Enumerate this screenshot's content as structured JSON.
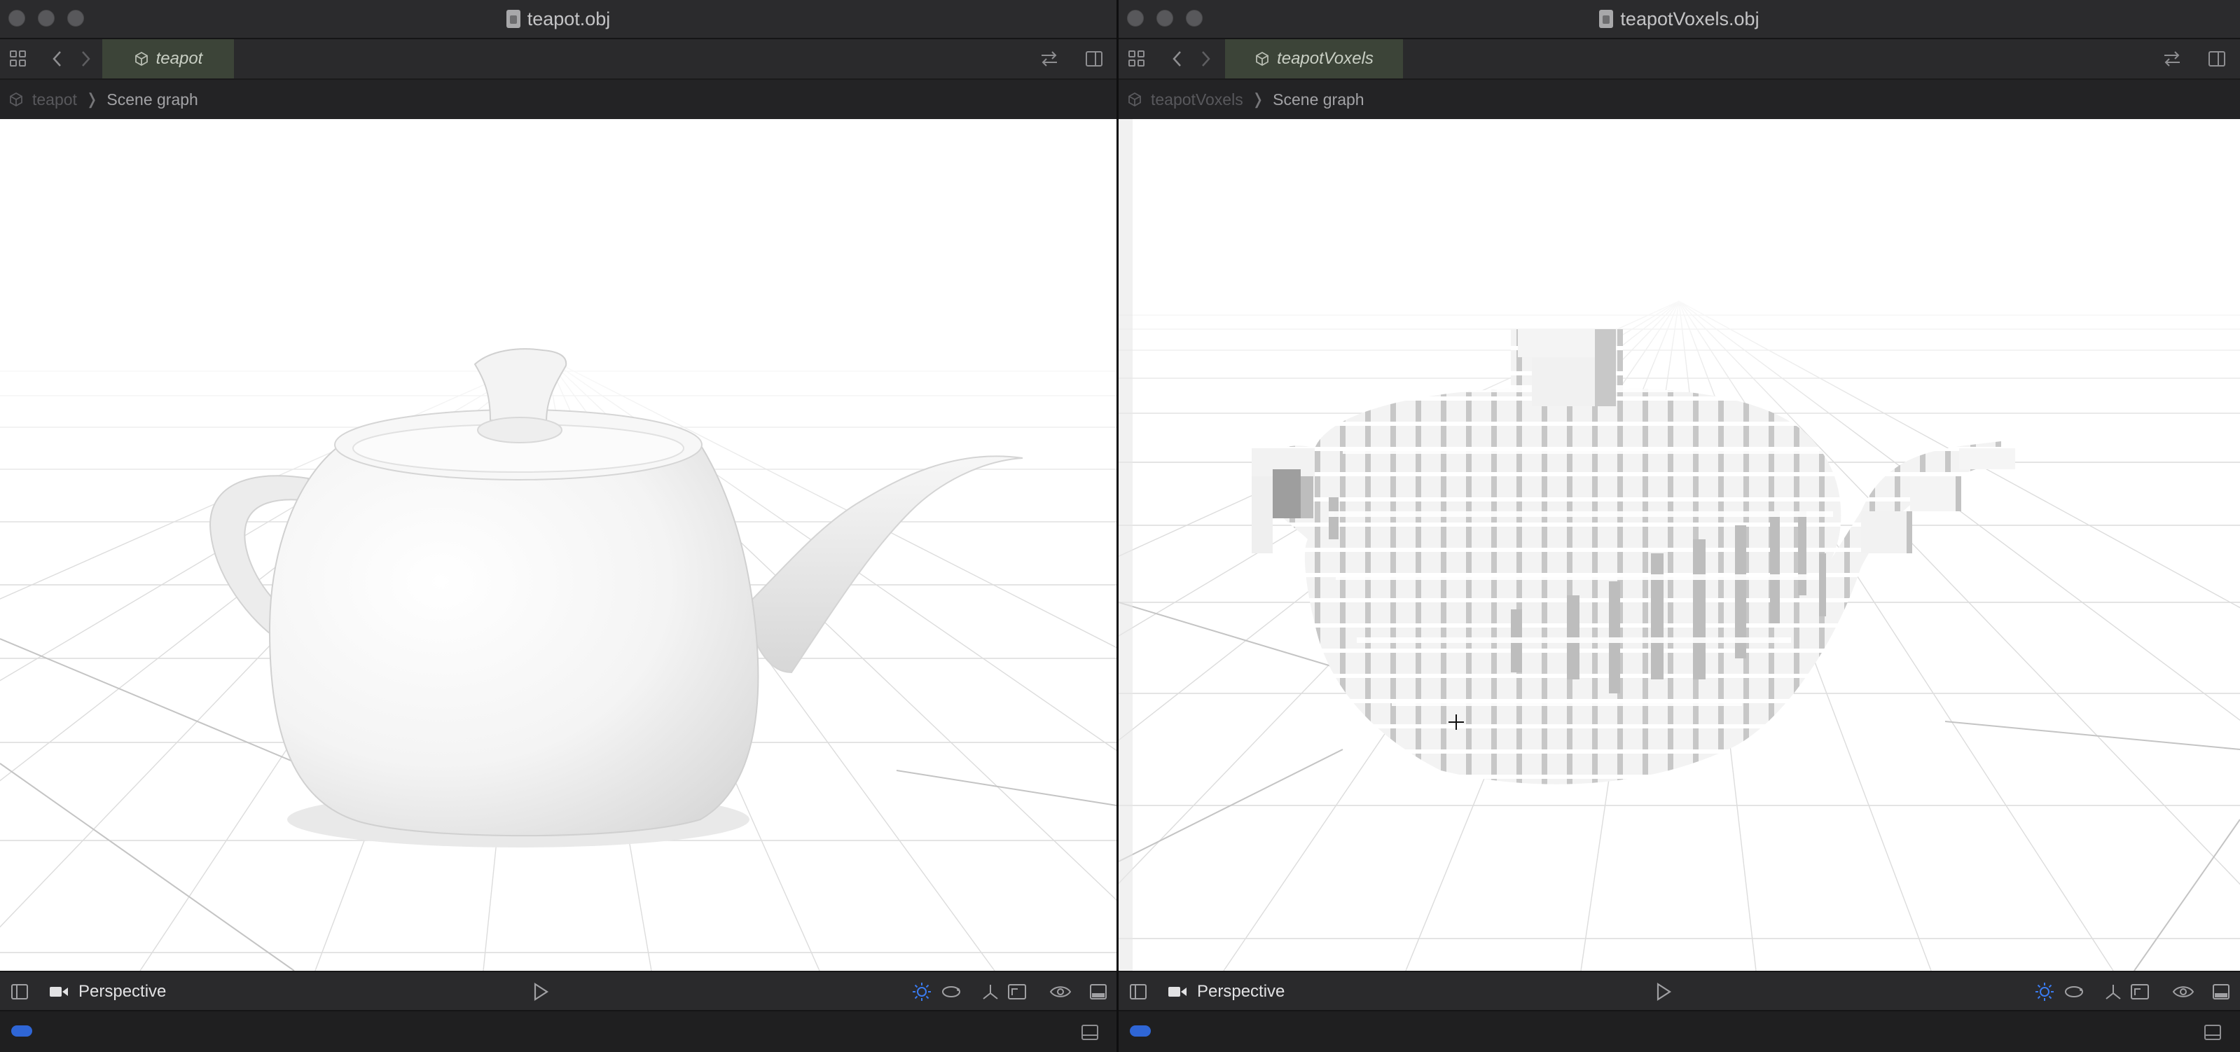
{
  "windows": [
    {
      "title": "teapot.obj",
      "tab_label": "teapot",
      "breadcrumb": {
        "root": "teapot",
        "separator": "❭",
        "current": "Scene graph"
      },
      "camera_mode": "Perspective",
      "model": "teapot"
    },
    {
      "title": "teapotVoxels.obj",
      "tab_label": "teapotVoxels",
      "breadcrumb": {
        "root": "teapotVoxels",
        "separator": "❭",
        "current": "Scene graph"
      },
      "camera_mode": "Perspective",
      "model": "teapot-voxels"
    }
  ],
  "colors": {
    "titlebar": "#2b2b2d",
    "tab_active": "#3c4438",
    "viewport_background": "#ffffff",
    "accent_light": "#3a7bf0",
    "status_pill": "#2f66d6"
  }
}
